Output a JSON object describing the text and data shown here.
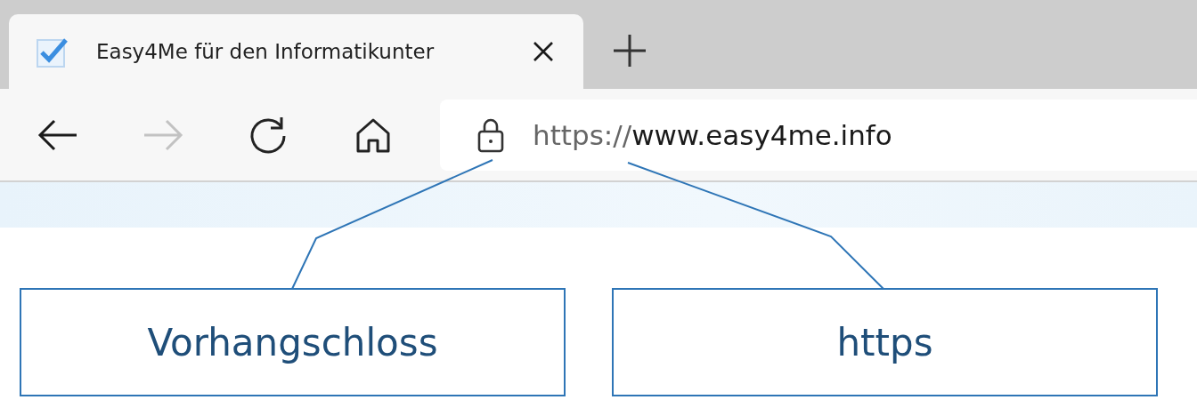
{
  "tab": {
    "title": "Easy4Me für den Informatikunter",
    "selected": true
  },
  "toolbar": {
    "back": {
      "disabled": false
    },
    "forward": {
      "disabled": true
    }
  },
  "address": {
    "scheme": "https://",
    "host": "www.easy4me.info"
  },
  "callouts": [
    {
      "text": "Vorhangschloss"
    },
    {
      "text": "https"
    }
  ]
}
